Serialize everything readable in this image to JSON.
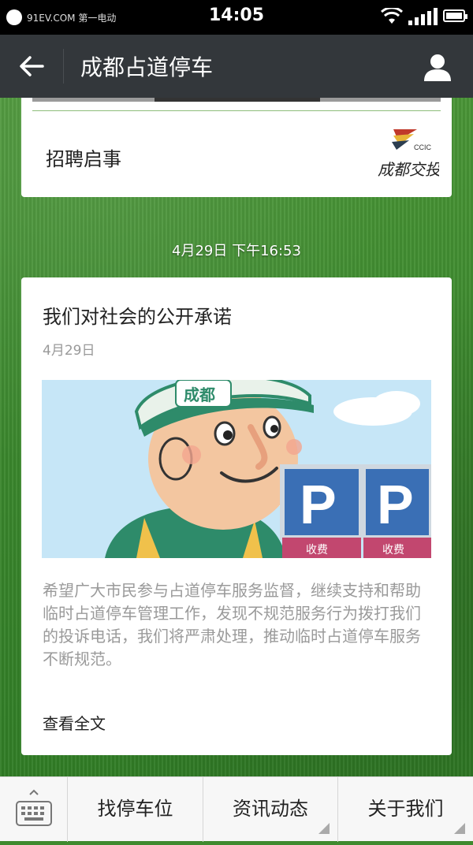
{
  "status_bar": {
    "carrier": "91EV.COM 第一电动",
    "time": "14:05"
  },
  "nav": {
    "title": "成都占道停车"
  },
  "card_top": {
    "heading": "招聘启事",
    "logo_text": "CCIC",
    "logo_caption": "成都交投"
  },
  "timestamp": "4月29日 下午16:53",
  "article": {
    "title": "我们对社会的公开承诺",
    "date": "4月29日",
    "cover_badge": "成都",
    "parking_sign": "P",
    "parking_sign_sub": "收费",
    "digest": "希望广大市民参与占道停车服务监督，继续支持和帮助临时占道停车管理工作，发现不规范服务行为拨打我们的投诉电话，我们将严肃处理，推动临时占道停车服务不断规范。",
    "read_more": "查看全文"
  },
  "bottom_menu": {
    "items": [
      {
        "label": "找停车位"
      },
      {
        "label": "资讯动态"
      },
      {
        "label": "关于我们"
      }
    ]
  },
  "colors": {
    "navbar": "#33373b",
    "card": "#ffffff",
    "background_grass": "#3e8b2f"
  }
}
